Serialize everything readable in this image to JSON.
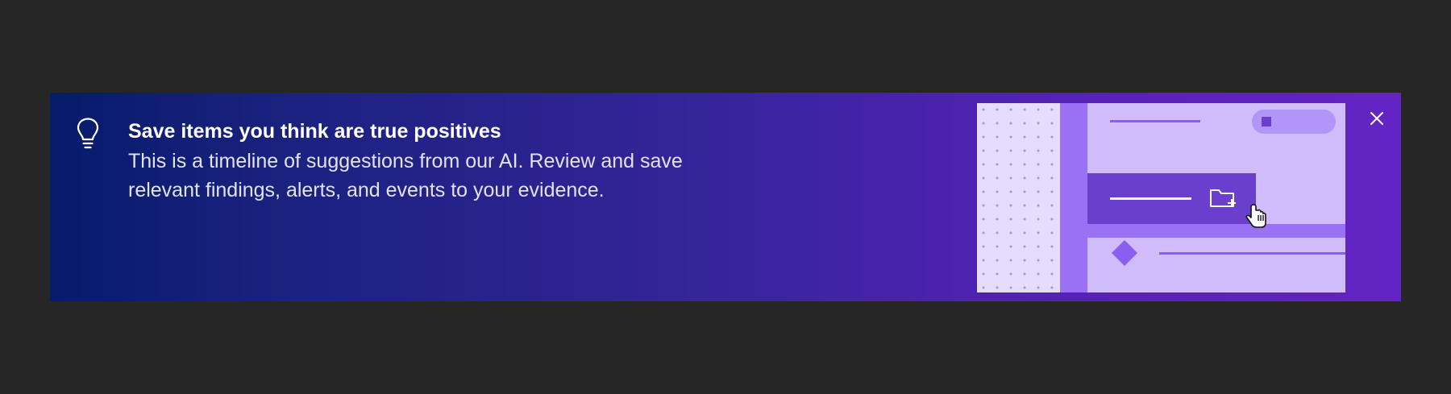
{
  "notification": {
    "title": "Save items you think are true positives",
    "body_line1": "This is a timeline of suggestions from our AI. Review and save",
    "body_line2": "relevant findings, alerts, and events to your evidence.",
    "icon": "lightbulb-icon",
    "close_icon": "close-icon"
  },
  "colors": {
    "background": "#262626",
    "gradient_start": "#061b6b",
    "gradient_end": "#6324c4",
    "illustration_light": "#d0bcfa",
    "illustration_mid": "#9a70f5",
    "illustration_dark": "#6a3fce"
  }
}
